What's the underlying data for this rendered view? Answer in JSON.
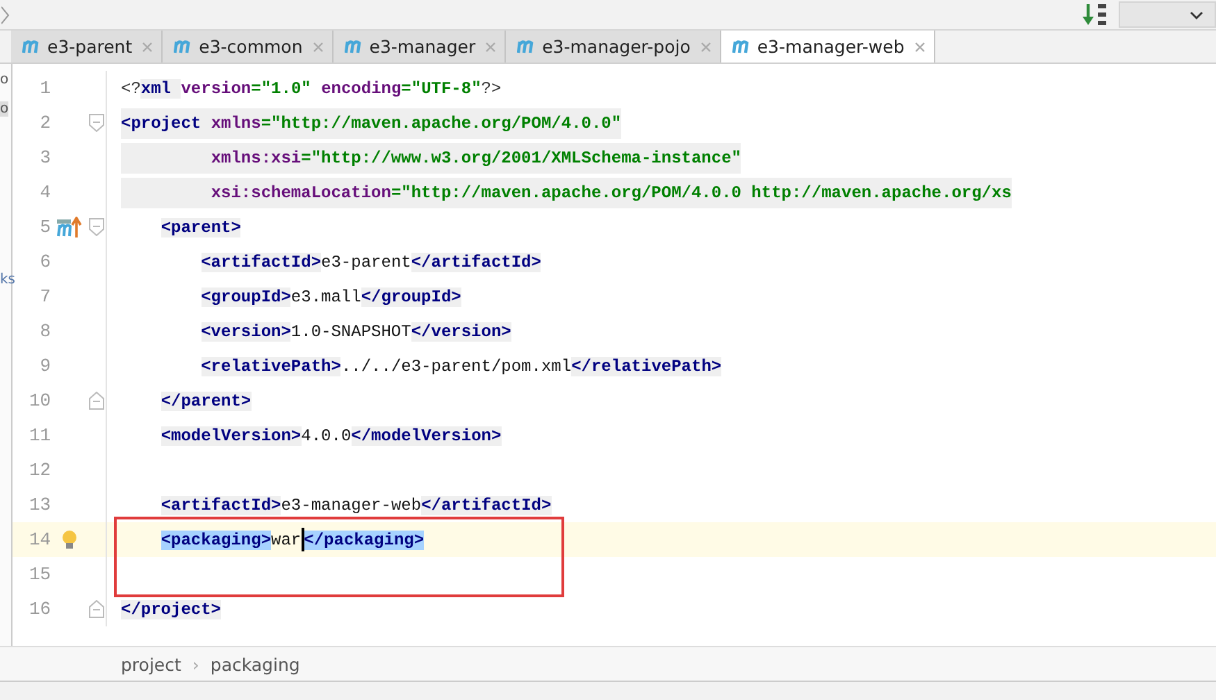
{
  "side_fragments": [
    "o",
    "o",
    "ks"
  ],
  "tabs": [
    {
      "label": "e3-parent",
      "selected": false
    },
    {
      "label": "e3-common",
      "selected": false
    },
    {
      "label": "e3-manager",
      "selected": false
    },
    {
      "label": "e3-manager-pojo",
      "selected": false
    },
    {
      "label": "e3-manager-web",
      "selected": true
    }
  ],
  "lines": [
    {
      "number": "1",
      "shaded": false,
      "current": false,
      "tokens": [
        {
          "kind": "punct",
          "text": "<?"
        },
        {
          "kind": "tag",
          "text": "xml "
        },
        {
          "kind": "attr",
          "text": "version"
        },
        {
          "kind": "str",
          "text": "=\"1.0\" "
        },
        {
          "kind": "attr",
          "text": "encoding"
        },
        {
          "kind": "str",
          "text": "=\"UTF-8\""
        },
        {
          "kind": "punct",
          "text": "?>"
        }
      ]
    },
    {
      "number": "2",
      "shaded": true,
      "current": false,
      "markers": [
        {
          "kind": "fold_open"
        }
      ],
      "tokens": [
        {
          "kind": "tag",
          "text": "<project "
        },
        {
          "kind": "attr",
          "text": "xmlns"
        },
        {
          "kind": "str",
          "text": "=\"http://maven.apache.org/POM/4.0.0\""
        }
      ]
    },
    {
      "number": "3",
      "shaded": true,
      "current": false,
      "tokens": [
        {
          "kind": "attr",
          "text": "         xmlns:xsi"
        },
        {
          "kind": "str",
          "text": "=\"http://www.w3.org/2001/XMLSchema-instance\""
        }
      ]
    },
    {
      "number": "4",
      "shaded": true,
      "current": false,
      "tokens": [
        {
          "kind": "attr",
          "text": "         xsi:schemaLocation"
        },
        {
          "kind": "str",
          "text": "=\"http://maven.apache.org/POM/4.0.0 http://maven.apache.org/xs"
        }
      ]
    },
    {
      "number": "5",
      "shaded": false,
      "current": false,
      "markers": [
        {
          "kind": "maven"
        },
        {
          "kind": "fold_open"
        }
      ],
      "tokens": [
        {
          "kind": "tag",
          "text": "    <parent>"
        }
      ]
    },
    {
      "number": "6",
      "shaded": false,
      "current": false,
      "tokens": [
        {
          "kind": "tag",
          "text": "        <artifactId>"
        },
        {
          "kind": "text",
          "text": "e3-parent"
        },
        {
          "kind": "tag",
          "text": "</artifactId>"
        }
      ]
    },
    {
      "number": "7",
      "shaded": false,
      "current": false,
      "tokens": [
        {
          "kind": "tag",
          "text": "        <groupId>"
        },
        {
          "kind": "text",
          "text": "e3.mall"
        },
        {
          "kind": "tag",
          "text": "</groupId>"
        }
      ]
    },
    {
      "number": "8",
      "shaded": false,
      "current": false,
      "tokens": [
        {
          "kind": "tag",
          "text": "        <version>"
        },
        {
          "kind": "text",
          "text": "1.0-SNAPSHOT"
        },
        {
          "kind": "tag",
          "text": "</version>"
        }
      ]
    },
    {
      "number": "9",
      "shaded": false,
      "current": false,
      "tokens": [
        {
          "kind": "tag",
          "text": "        <relativePath>"
        },
        {
          "kind": "text",
          "text": "../../e3-parent/pom.xml"
        },
        {
          "kind": "tag",
          "text": "</relativePath>"
        }
      ]
    },
    {
      "number": "10",
      "shaded": false,
      "current": false,
      "markers": [
        {
          "kind": "fold_close"
        }
      ],
      "tokens": [
        {
          "kind": "tag",
          "text": "    </parent>"
        }
      ]
    },
    {
      "number": "11",
      "shaded": false,
      "current": false,
      "tokens": [
        {
          "kind": "tag",
          "text": "    <modelVersion>"
        },
        {
          "kind": "text",
          "text": "4.0.0"
        },
        {
          "kind": "tag",
          "text": "</modelVersion>"
        }
      ]
    },
    {
      "number": "12",
      "current": false
    },
    {
      "number": "13",
      "shaded": false,
      "current": false,
      "tokens": [
        {
          "kind": "tag",
          "text": "    <artifactId>"
        },
        {
          "kind": "text",
          "text": "e3-manager-web"
        },
        {
          "kind": "tag",
          "text": "</artifactId>"
        }
      ]
    },
    {
      "number": "14",
      "shaded": false,
      "current": true,
      "markers": [
        {
          "kind": "bulb"
        }
      ],
      "tokens": [
        {
          "kind": "sel",
          "text": "    <packaging>"
        },
        {
          "kind": "text",
          "text": "war"
        },
        {
          "kind": "caret"
        },
        {
          "kind": "sel",
          "text": "</packaging>"
        }
      ]
    },
    {
      "number": "15",
      "current": false
    },
    {
      "number": "16",
      "shaded": false,
      "current": false,
      "markers": [
        {
          "kind": "fold_close"
        }
      ],
      "tokens": [
        {
          "kind": "tag",
          "text": "</project>"
        }
      ]
    }
  ],
  "breadcrumb": [
    "project",
    "›",
    "packaging"
  ]
}
